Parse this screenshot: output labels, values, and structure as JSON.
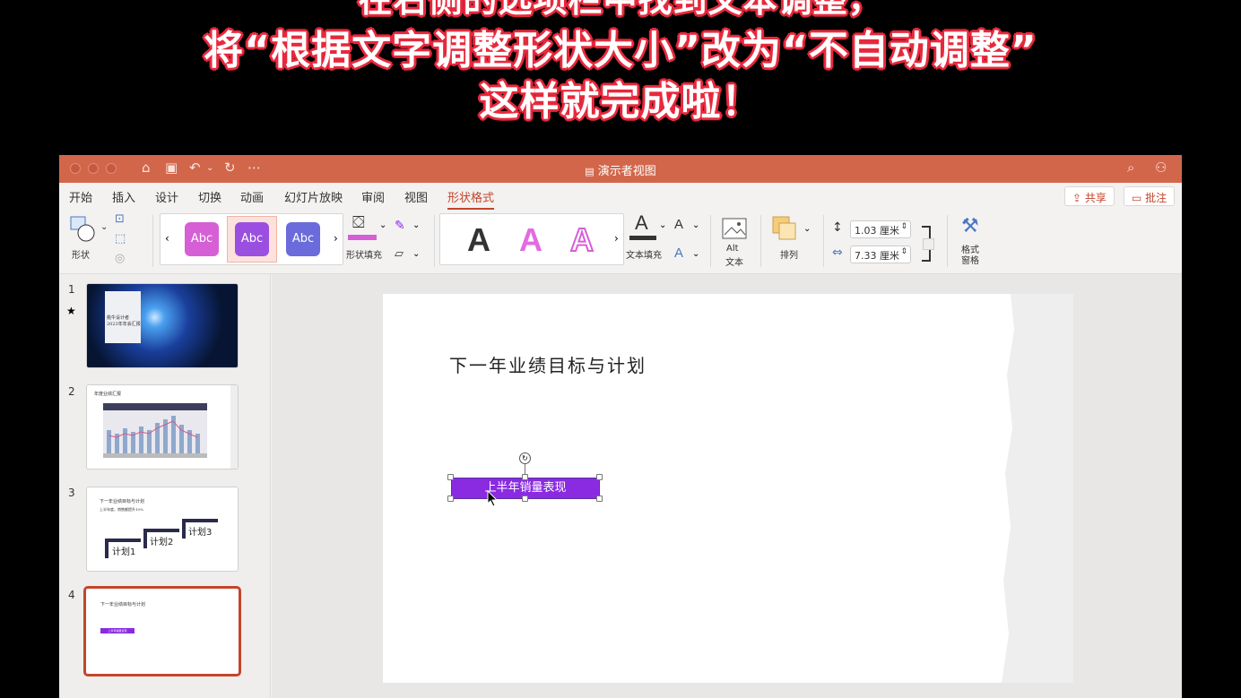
{
  "caption": {
    "line1": "在右侧的选项栏中找到文本调整，",
    "line2": "将“根据文字调整形状大小”改为“不自动调整”",
    "line3": "这样就完成啦！"
  },
  "window": {
    "title": "演示者视图",
    "title_icon": "document-icon"
  },
  "menu": {
    "tabs": [
      "开始",
      "插入",
      "设计",
      "切换",
      "动画",
      "幻灯片放映",
      "审阅",
      "视图",
      "形状格式"
    ],
    "active_tab": "形状格式",
    "share_label": "共享",
    "comment_label": "批注"
  },
  "ribbon": {
    "shape_label": "形状",
    "style_samples": [
      "Abc",
      "Abc",
      "Abc"
    ],
    "shape_fill_label": "形状填充",
    "wordart_samples": [
      "A",
      "A",
      "A"
    ],
    "text_fill_label": "文本填充",
    "alt_text_line1": "Alt",
    "alt_text_line2": "文本",
    "arrange_label": "排列",
    "height_value": "1.03 厘米",
    "width_value": "7.33 厘米",
    "format_pane_line1": "格式",
    "format_pane_line2": "窗格"
  },
  "slides": {
    "numbers": [
      "1",
      "2",
      "3",
      "4"
    ],
    "thumb1_line1": "桃牛设计者",
    "thumb1_line2": "2023年年会汇报",
    "thumb2_title": "年度业绩汇报",
    "thumb3_title": "下一年业绩目标与计划",
    "thumb3_sub": "上半年度，销售额提升10%",
    "thumb3_steps": [
      "计划1",
      "计划2",
      "计划3"
    ],
    "thumb4_title": "下一年业绩目标与计划",
    "thumb4_box": "上半年销量表现"
  },
  "slide": {
    "title": "下一年业绩目标与计划",
    "shape_text": "上半年销量表现"
  },
  "colors": {
    "titlebar": "#d2664b",
    "accent": "#c4452a",
    "shape_fill": "#8a2be2",
    "caption_outline": "#e8283c"
  }
}
